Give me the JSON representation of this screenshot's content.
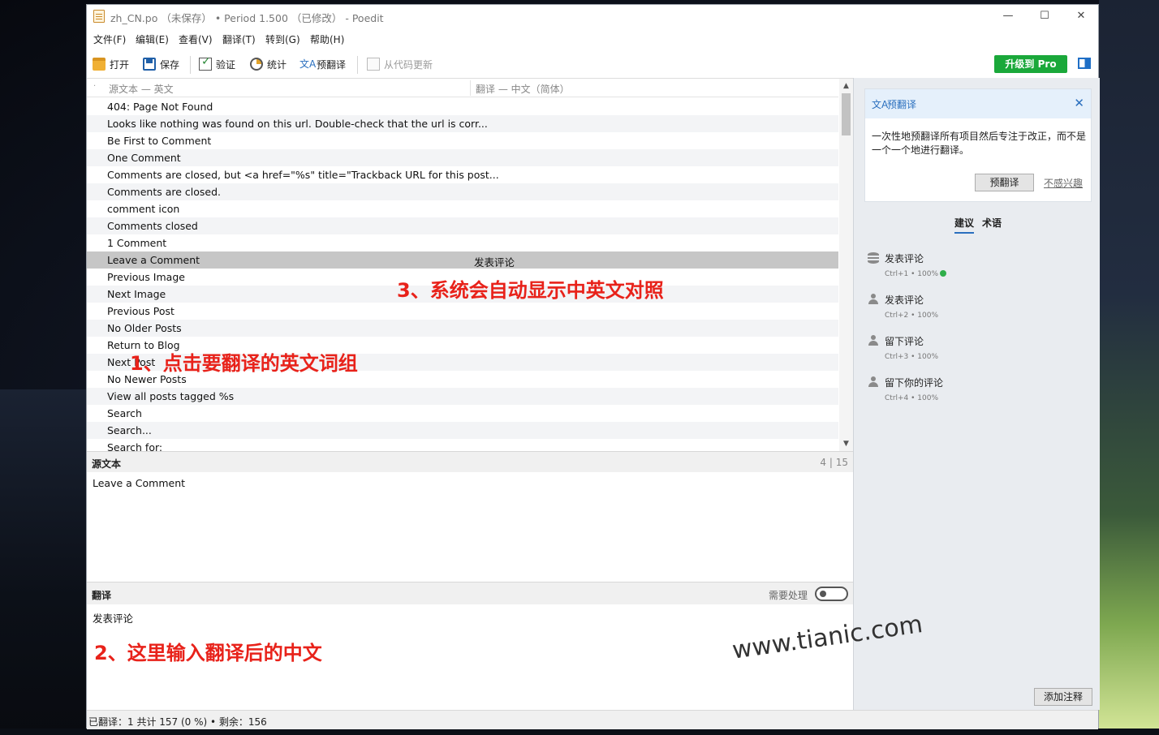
{
  "window": {
    "title": "zh_CN.po （未保存） • Period 1.500 （已修改） - Poedit",
    "controls": {
      "minimize": "—",
      "maximize": "☐",
      "close": "✕"
    }
  },
  "menu": [
    "文件(F)",
    "编辑(E)",
    "查看(V)",
    "翻译(T)",
    "转到(G)",
    "帮助(H)"
  ],
  "toolbar": {
    "open": "打开",
    "save": "保存",
    "validate": "验证",
    "stats": "统计",
    "pretranslate": "预翻译",
    "update_from_code": "从代码更新",
    "upgrade_pro": "升级到 Pro"
  },
  "list": {
    "header_marker": "·",
    "source_header": "源文本 — 英文",
    "translation_header": "翻译 — 中文（简体）",
    "rows": [
      {
        "source": "404: Page Not Found",
        "translation": ""
      },
      {
        "source": "Looks like nothing was found on this url.  Double-check that the url is corr...",
        "translation": ""
      },
      {
        "source": "Be First to Comment",
        "translation": ""
      },
      {
        "source": "One Comment",
        "translation": ""
      },
      {
        "source": "Comments are closed, but <a href=\"%s\" title=\"Trackback URL for this post...",
        "translation": ""
      },
      {
        "source": "Comments are closed.",
        "translation": ""
      },
      {
        "source": "comment icon",
        "translation": ""
      },
      {
        "source": "Comments closed",
        "translation": ""
      },
      {
        "source": "1 Comment",
        "translation": ""
      },
      {
        "source": "Leave a Comment",
        "translation": "发表评论",
        "selected": true
      },
      {
        "source": "Previous Image",
        "translation": ""
      },
      {
        "source": "Next Image",
        "translation": ""
      },
      {
        "source": "Previous Post",
        "translation": ""
      },
      {
        "source": "No Older Posts",
        "translation": ""
      },
      {
        "source": "Return to Blog",
        "translation": ""
      },
      {
        "source": "Next Post",
        "translation": ""
      },
      {
        "source": "No Newer Posts",
        "translation": ""
      },
      {
        "source": "View all posts tagged %s",
        "translation": ""
      },
      {
        "source": "Search",
        "translation": ""
      },
      {
        "source": "Search...",
        "translation": ""
      },
      {
        "source": "Search for:",
        "translation": ""
      }
    ]
  },
  "source_panel": {
    "label": "源文本",
    "counter": "4 | 15",
    "text": "Leave a Comment"
  },
  "translation_panel": {
    "label": "翻译",
    "fuzzy_label": "需要处理",
    "fuzzy_on": false,
    "text": "发表评论"
  },
  "sidebar": {
    "pretranslate_card": {
      "icon": "translate-icon",
      "title": "预翻译",
      "description": "一次性地预翻译所有项目然后专注于改正，而不是一个一个地进行翻译。",
      "button": "预翻译",
      "dismiss": "不感兴趣"
    },
    "tabs": [
      "建议",
      "术语"
    ],
    "suggestions": [
      {
        "icon": "database-icon",
        "text": "发表评论",
        "meta": "Ctrl+1 • 100%",
        "verified": true
      },
      {
        "icon": "user-icon",
        "text": "发表评论",
        "meta": "Ctrl+2 • 100%",
        "verified": false
      },
      {
        "icon": "user-icon",
        "text": "留下评论",
        "meta": "Ctrl+3 • 100%",
        "verified": false
      },
      {
        "icon": "user-icon",
        "text": "留下你的评论",
        "meta": "Ctrl+4 • 100%",
        "verified": false
      }
    ],
    "add_note": "添加注释"
  },
  "status_bar": "已翻译：1 共计 157 (0 %)  •  剩余：156",
  "annotations": {
    "step1": "1、点击要翻译的英文词组",
    "step2": "2、这里输入翻译后的中文",
    "step3": "3、系统会自动显示中英文对照"
  },
  "watermark": "www.tianic.com",
  "colors": {
    "pro_button": "#1aa83a",
    "accent": "#2a6fbe",
    "selected_row": "#c6c6c6",
    "annotation": "#e8221a"
  }
}
